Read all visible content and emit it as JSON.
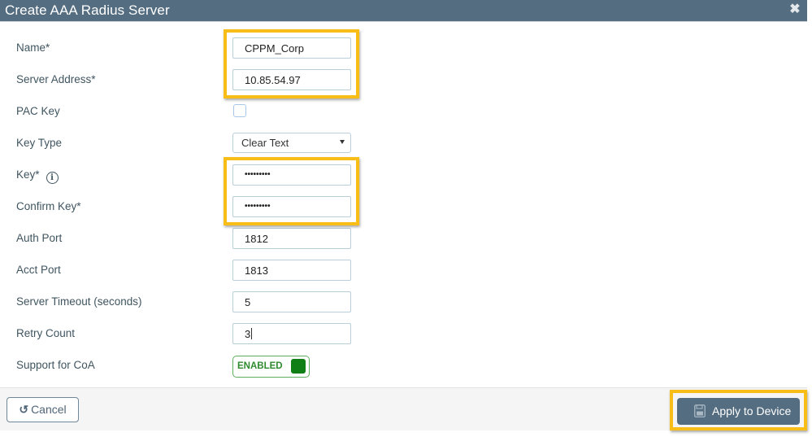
{
  "dialog": {
    "title": "Create AAA Radius Server",
    "close_icon": "close-icon"
  },
  "form": {
    "name": {
      "label": "Name*",
      "value": "CPPM_Corp"
    },
    "server_address": {
      "label": "Server Address*",
      "value": "10.85.54.97"
    },
    "pac_key": {
      "label": "PAC Key",
      "checked": false
    },
    "key_type": {
      "label": "Key Type",
      "selected": "Clear Text"
    },
    "key": {
      "label": "Key*",
      "value": "•••••••••",
      "info_icon": "info-icon"
    },
    "confirm_key": {
      "label": "Confirm Key*",
      "value": "•••••••••"
    },
    "auth_port": {
      "label": "Auth Port",
      "value": "1812"
    },
    "acct_port": {
      "label": "Acct Port",
      "value": "1813"
    },
    "server_timeout": {
      "label": "Server Timeout (seconds)",
      "value": "5"
    },
    "retry_count": {
      "label": "Retry Count",
      "value": "3"
    },
    "support_coa": {
      "label": "Support for CoA",
      "state": "ENABLED"
    }
  },
  "footer": {
    "cancel_label": "Cancel",
    "cancel_icon": "undo-icon",
    "apply_label": "Apply to Device",
    "apply_icon": "save-icon"
  },
  "colors": {
    "header_bg": "#546d81",
    "highlight": "#f8bd17",
    "toggle_on": "#0f7f16",
    "footer_bg": "#f5f5f5"
  }
}
